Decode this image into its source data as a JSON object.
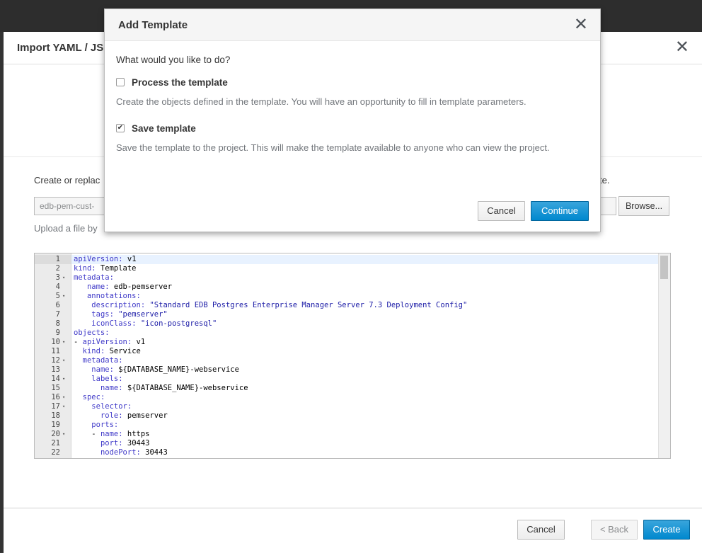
{
  "base_modal": {
    "title": "Import YAML / JSON",
    "close_icon": "close-icon",
    "description_start": "Create or replac",
    "description_end": "te.",
    "file_input_value": "edb-pem-cust-",
    "browse_label": "Browse...",
    "help_text": "Upload a file by",
    "footer": {
      "cancel_label": "Cancel",
      "back_label": "< Back",
      "create_label": "Create"
    }
  },
  "editor": {
    "lines": [
      {
        "n": "1",
        "fold": "",
        "key": "apiVersion",
        "val": " v1",
        "indent": ""
      },
      {
        "n": "2",
        "fold": "",
        "key": "kind",
        "val": " Template",
        "indent": ""
      },
      {
        "n": "3",
        "fold": "▾",
        "key": "metadata",
        "val": "",
        "indent": ""
      },
      {
        "n": "4",
        "fold": "",
        "key": "name",
        "val": " edb-pemserver",
        "indent": "   "
      },
      {
        "n": "5",
        "fold": "▾",
        "key": "annotations",
        "val": "",
        "indent": "   "
      },
      {
        "n": "6",
        "fold": "",
        "key": "description",
        "val": " \"Standard EDB Postgres Enterprise Manager Server 7.3 Deployment Config\"",
        "indent": "    ",
        "str": true
      },
      {
        "n": "7",
        "fold": "",
        "key": "tags",
        "val": " \"pemserver\"",
        "indent": "    ",
        "str": true
      },
      {
        "n": "8",
        "fold": "",
        "key": "iconClass",
        "val": " \"icon-postgresql\"",
        "indent": "    ",
        "str": true
      },
      {
        "n": "9",
        "fold": "",
        "key": "objects",
        "val": "",
        "indent": ""
      },
      {
        "n": "10",
        "fold": "▾",
        "key": "apiVersion",
        "val": " v1",
        "indent": "- "
      },
      {
        "n": "11",
        "fold": "",
        "key": "kind",
        "val": " Service",
        "indent": "  "
      },
      {
        "n": "12",
        "fold": "▾",
        "key": "metadata",
        "val": "",
        "indent": "  "
      },
      {
        "n": "13",
        "fold": "",
        "key": "name",
        "val": " ${DATABASE_NAME}-webservice",
        "indent": "    "
      },
      {
        "n": "14",
        "fold": "▾",
        "key": "labels",
        "val": "",
        "indent": "    "
      },
      {
        "n": "15",
        "fold": "",
        "key": "name",
        "val": " ${DATABASE_NAME}-webservice",
        "indent": "      "
      },
      {
        "n": "16",
        "fold": "▾",
        "key": "spec",
        "val": "",
        "indent": "  "
      },
      {
        "n": "17",
        "fold": "▾",
        "key": "selector",
        "val": "",
        "indent": "    "
      },
      {
        "n": "18",
        "fold": "",
        "key": "role",
        "val": " pemserver",
        "indent": "      "
      },
      {
        "n": "19",
        "fold": "",
        "key": "ports",
        "val": "",
        "indent": "    "
      },
      {
        "n": "20",
        "fold": "▾",
        "key": "name",
        "val": " https",
        "indent": "    - "
      },
      {
        "n": "21",
        "fold": "",
        "key": "port",
        "val": " 30443",
        "indent": "      "
      },
      {
        "n": "22",
        "fold": "",
        "key": "nodePort",
        "val": " 30443",
        "indent": "      "
      }
    ]
  },
  "dialog": {
    "title": "Add Template",
    "close_icon": "close-icon",
    "question": "What would you like to do?",
    "options": [
      {
        "label": "Process the template",
        "checked": false,
        "description": "Create the objects defined in the template. You will have an opportunity to fill in template parameters."
      },
      {
        "label": "Save template",
        "checked": true,
        "description": "Save the template to the project. This will make the template available to anyone who can view the project."
      }
    ],
    "cancel_label": "Cancel",
    "continue_label": "Continue"
  }
}
